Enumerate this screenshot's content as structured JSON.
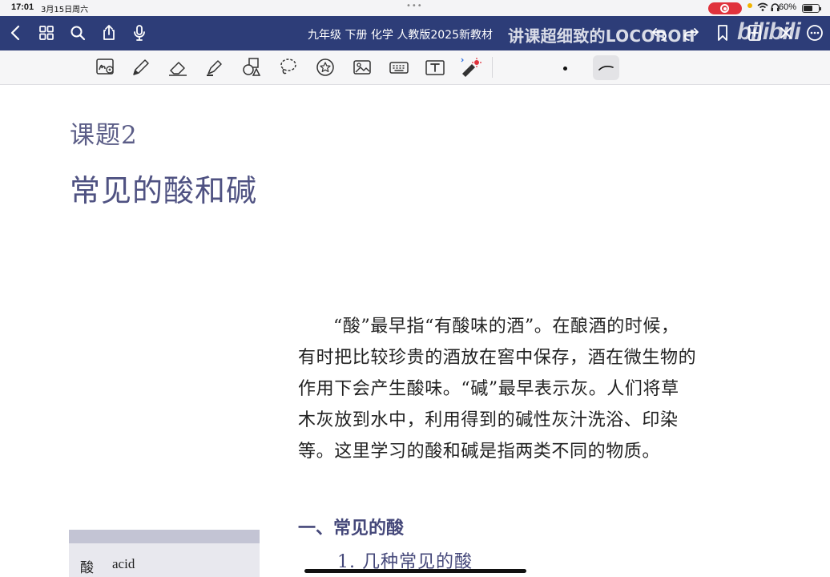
{
  "status_bar": {
    "time": "17:01",
    "date": "3月15日周六",
    "battery": "60%",
    "battery_level": 0.6
  },
  "nav": {
    "title": "九年级 下册 化学 人教版2025新教材",
    "watermark": "讲课超细致的LOCOROH",
    "watermark_logo": "bilibili",
    "icons": [
      "back-icon",
      "grid-icon",
      "search-icon",
      "share-icon",
      "microphone-icon",
      "undo-icon",
      "redo-icon",
      "bookmark-icon",
      "add-page-icon",
      "close-icon",
      "more-icon"
    ]
  },
  "toolbar": {
    "tools": [
      "handwriting-to-text-icon",
      "pen-icon",
      "eraser-icon",
      "highlighter-icon",
      "shapes-icon",
      "lasso-icon",
      "sticker-icon",
      "image-icon",
      "keyboard-icon",
      "text-box-icon",
      "laser-pointer-icon"
    ],
    "selected_tool": "pen-icon"
  },
  "content": {
    "lesson_number": "课题2",
    "lesson_title": "常见的酸和碱",
    "intro_lines": [
      "“酸”最早指“有酸味的酒”。在酿酒的时候，",
      "有时把比较珍贵的酒放在窖中保存，酒在微生物的",
      "作用下会产生酸味。“碱”最早表示灰。人们将草",
      "木灰放到水中，利用得到的碱性灰汁洗浴、印染",
      "等。这里学习的酸和碱是指两类不同的物质。"
    ],
    "section_heading": "一、常见的酸",
    "sub_heading": "1. 几种常见的酸",
    "sidebar_term_zh": "酸",
    "sidebar_term_en": "acid"
  },
  "colors": {
    "nav_bg": "#2d3d78",
    "heading": "#4f5282",
    "record": "#e0323c"
  }
}
